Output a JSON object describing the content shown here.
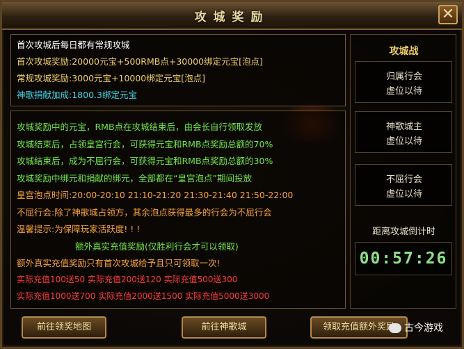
{
  "title": "攻城奖励",
  "close_glyph": "✕",
  "top_lines": [
    {
      "text": "首次攻城后每日都有常规攻城",
      "color": "white"
    },
    {
      "text": "首次攻城奖励:20000元宝+500RMB点+30000绑定元宝[泡点]",
      "color": "gold"
    },
    {
      "text": "常规攻城奖励:3000元宝+10000绑定元宝[泡点]",
      "color": "gold"
    },
    {
      "text": "神歌捐献加成:1800.3绑定元宝",
      "color": "cyan"
    }
  ],
  "mid_lines": [
    {
      "text": "攻城奖励中的元宝，RMB点在攻城结束后，由会长自行领取发放",
      "color": "green"
    },
    {
      "text": "攻城结束后，占领皇宫行会，可获得元宝和RMB点奖励总额的70%",
      "color": "green"
    },
    {
      "text": "攻城结束后，成为不屈行会，可获得元宝和RMB点奖励总额的30%",
      "color": "green"
    },
    {
      "text": "攻城奖励中绑元和捐献的绑元，全部都在“皇宫泡点”期间投放",
      "color": "green"
    },
    {
      "text": "皇宫泡点时间:20:00-20:10   21:10-21:20   21:30-21:40   21:50-22:00",
      "color": "orange"
    },
    {
      "text": "不屈行会:除了神歌城占领方，其余泡点获得最多的行会为不屈行会",
      "color": "orange"
    },
    {
      "text": "温馨提示:为保障玩家活跃度! ! !",
      "color": "orange"
    },
    {
      "text": "额外真实充值奖励(仅胜利行会才可以领取)",
      "color": "green",
      "indent": true
    },
    {
      "text": "额外真实充值奖励只有首次攻城给予且只可领取一次!",
      "color": "orange"
    },
    {
      "text": "实际充值100送50     实际充值200送120     实际充值500送300",
      "color": "red",
      "small": true
    },
    {
      "text": "实际充值1000送700    实际充值2000送1500    实际充值5000送3000",
      "color": "red",
      "small": true
    }
  ],
  "side": {
    "title": "攻城战",
    "boxes": [
      {
        "line1": "归属行会",
        "line2": "虚位以待"
      },
      {
        "line1": "神歌城主",
        "line2": "虚位以待"
      },
      {
        "line1": "不屈行会",
        "line2": "虚位以待"
      }
    ],
    "countdown_label": "距离攻城倒计时",
    "countdown": "00:57:26"
  },
  "buttons": {
    "map": "前往领奖地图",
    "city": "前往神歌城",
    "claim": "领取充值额外奖励"
  },
  "watermark": "古今游戏"
}
